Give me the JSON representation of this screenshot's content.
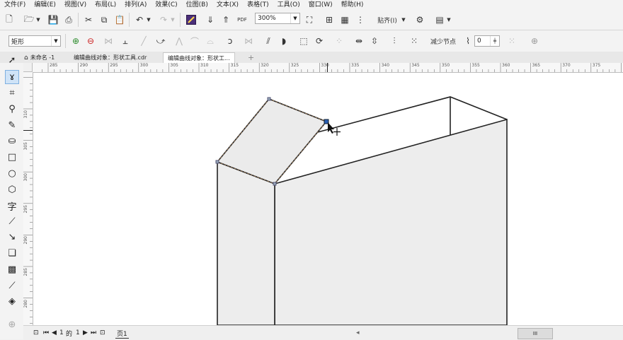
{
  "menu": [
    "文件(F)",
    "编辑(E)",
    "视图(V)",
    "布局(L)",
    "排列(A)",
    "效果(C)",
    "位图(B)",
    "文本(X)",
    "表格(T)",
    "工具(O)",
    "窗口(W)",
    "帮助(H)"
  ],
  "toolbar": {
    "zoom_value": "300%",
    "snap_label": "贴齐(I)"
  },
  "property_bar": {
    "object_type": "矩形",
    "reduce_nodes_label": "减少节点",
    "smoothness_value": "0"
  },
  "doc_tabs": [
    "未命名 -1",
    "编辑曲线对象：形状工具.cdr",
    "编辑曲线对象：形状工..."
  ],
  "rulers": {
    "horizontal": [
      "285",
      "290",
      "295",
      "300",
      "305",
      "310",
      "315",
      "320",
      "325",
      "330",
      "335",
      "340",
      "345",
      "350",
      "355",
      "360",
      "365",
      "370",
      "375"
    ],
    "vertical": [
      "310",
      "305",
      "300",
      "295",
      "290",
      "285",
      "280",
      "275"
    ]
  },
  "status": {
    "page_counter_prefix": "1",
    "page_counter_of": "的",
    "page_counter_total": "1",
    "page_tab": "页1",
    "scroll_grip": "III"
  },
  "icons": [
    "select-icon",
    "shape-icon",
    "crop-icon",
    "zoom-icon",
    "freehand-icon",
    "smart-fill-icon",
    "rectangle-icon",
    "ellipse-icon",
    "polygon-icon",
    "text-icon",
    "parallel-dimension-icon",
    "connector-icon",
    "drop-shadow-icon",
    "transparency-icon",
    "eyedropper-icon",
    "interactive-fill-icon"
  ]
}
